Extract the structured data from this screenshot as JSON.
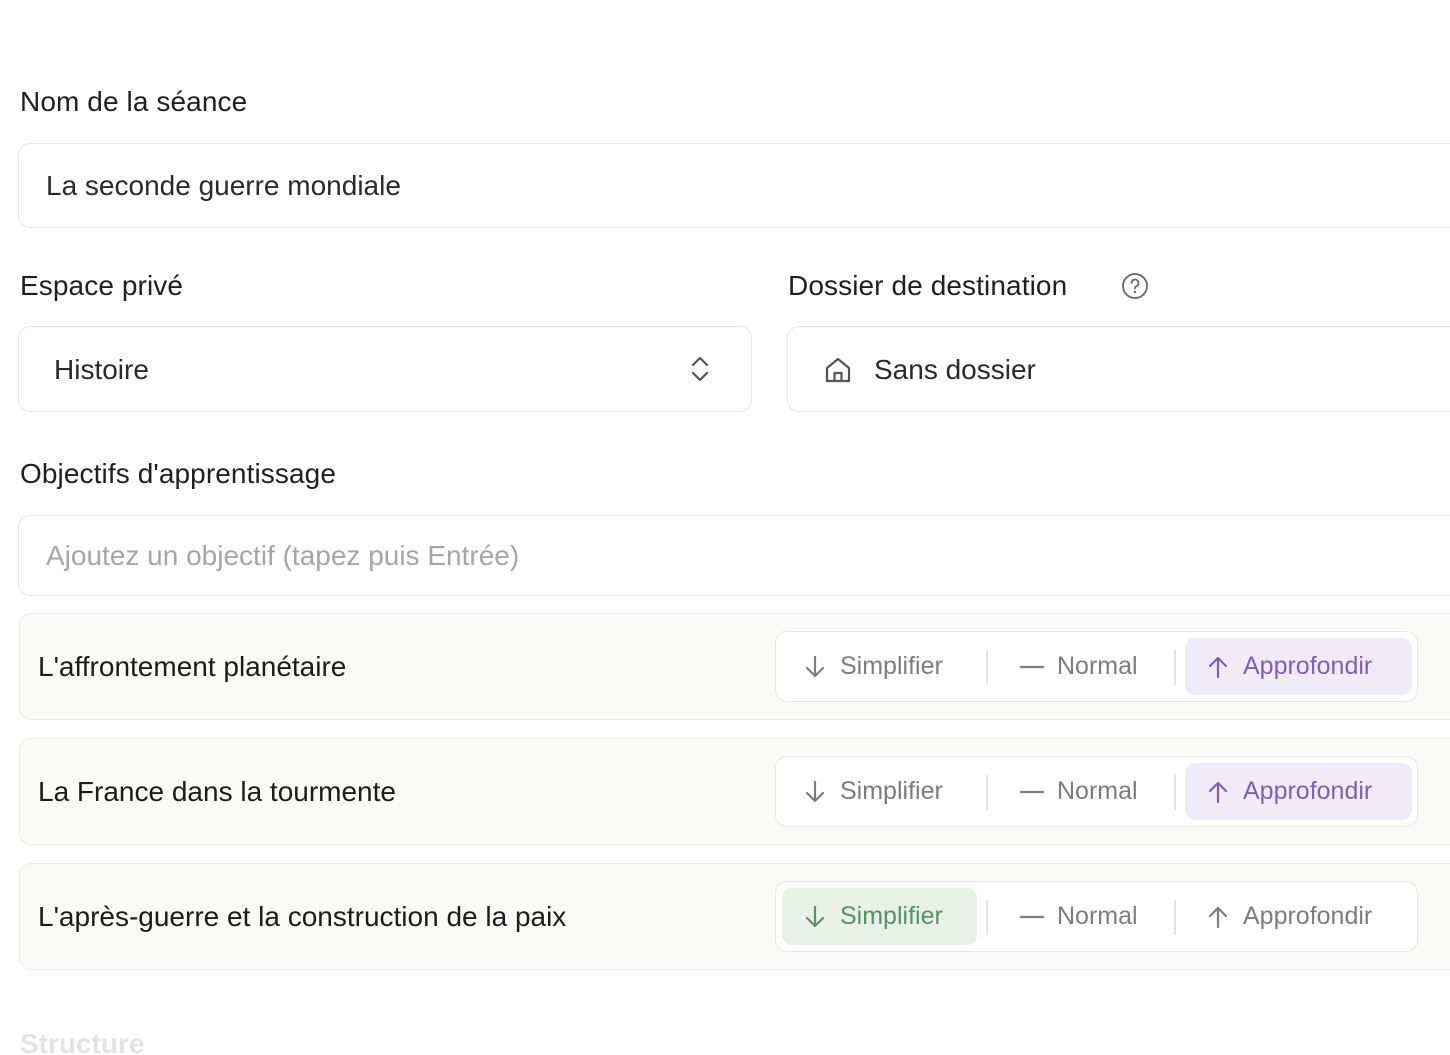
{
  "session": {
    "name_label": "Nom de la séance",
    "name_value": "La seconde guerre mondiale"
  },
  "space": {
    "label": "Espace privé",
    "value": "Histoire",
    "icon": "chevron-up-down-icon"
  },
  "destination": {
    "label": "Dossier de destination",
    "help_icon": "question-circle-icon",
    "value": "Sans dossier",
    "icon": "home-icon"
  },
  "objectives": {
    "label": "Objectifs d'apprentissage",
    "input_placeholder": "Ajoutez un objectif (tapez puis Entrée)",
    "options": {
      "simplify": "Simplifier",
      "normal": "Normal",
      "deepen": "Approfondir"
    },
    "items": [
      {
        "title": "L'affrontement planétaire",
        "selected": "deepen"
      },
      {
        "title": "La France dans la tourmente",
        "selected": "deepen"
      },
      {
        "title": "L'après-guerre et la construction de la paix",
        "selected": "simplify"
      }
    ]
  },
  "next_section": {
    "heading": "Structure"
  },
  "colors": {
    "deepen_active_bg": "#f0ebf8",
    "deepen_active_text": "#7e62b1",
    "simplify_active_bg": "#e7f1e8",
    "simplify_active_text": "#5c8f66",
    "border": "#e6e6e3"
  }
}
